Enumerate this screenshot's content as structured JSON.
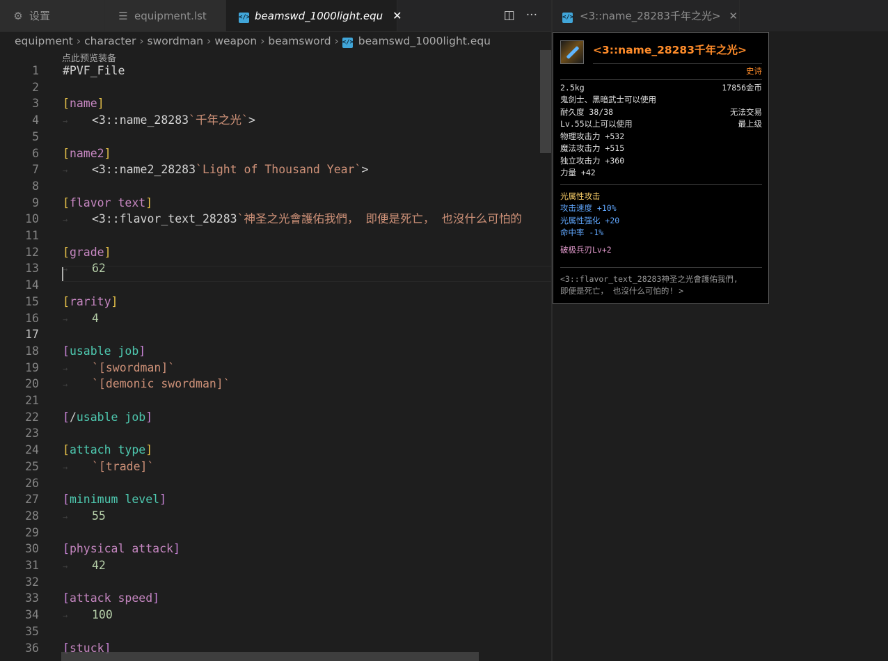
{
  "tabs": [
    {
      "label": "设置",
      "icon": "settings-sliders-icon"
    },
    {
      "label": "equipment.lst",
      "icon": "list-icon"
    },
    {
      "label": "beamswd_1000light.equ",
      "icon": "code-file-icon",
      "close": "✕"
    }
  ],
  "actions": {
    "split": "◫",
    "more": "···"
  },
  "breadcrumb": [
    "equipment",
    "character",
    "swordman",
    "weapon",
    "beamsword",
    "beamswd_1000light.equ"
  ],
  "codelens": "点此预览装备",
  "lines": [
    {
      "n": "1",
      "code": "#PVF_File"
    },
    {
      "n": "2",
      "code": ""
    },
    {
      "n": "3",
      "code": "[name]"
    },
    {
      "n": "4",
      "code": "<3::name_28283`千年之光`>"
    },
    {
      "n": "5",
      "code": ""
    },
    {
      "n": "6",
      "code": "[name2]"
    },
    {
      "n": "7",
      "code": "<3::name2_28283`Light of Thousand Year`>"
    },
    {
      "n": "8",
      "code": ""
    },
    {
      "n": "9",
      "code": "[flavor text]"
    },
    {
      "n": "10",
      "code": "<3::flavor_text_28283`神圣之光會護佑我們， 即便是死亡， 也沒什么可怕的"
    },
    {
      "n": "11",
      "code": ""
    },
    {
      "n": "12",
      "code": "[grade]"
    },
    {
      "n": "13",
      "code": "62"
    },
    {
      "n": "14",
      "code": ""
    },
    {
      "n": "15",
      "code": "[rarity]"
    },
    {
      "n": "16",
      "code": "4"
    },
    {
      "n": "17",
      "code": ""
    },
    {
      "n": "18",
      "code": "[usable job]"
    },
    {
      "n": "19",
      "code": "`[swordman]`"
    },
    {
      "n": "20",
      "code": "`[demonic swordman]`"
    },
    {
      "n": "21",
      "code": ""
    },
    {
      "n": "22",
      "code": "[/usable job]"
    },
    {
      "n": "23",
      "code": ""
    },
    {
      "n": "24",
      "code": "[attach type]"
    },
    {
      "n": "25",
      "code": "`[trade]`"
    },
    {
      "n": "26",
      "code": ""
    },
    {
      "n": "27",
      "code": "[minimum level]"
    },
    {
      "n": "28",
      "code": "55"
    },
    {
      "n": "29",
      "code": ""
    },
    {
      "n": "30",
      "code": "[physical attack]"
    },
    {
      "n": "31",
      "code": "42"
    },
    {
      "n": "32",
      "code": ""
    },
    {
      "n": "33",
      "code": "[attack speed]"
    },
    {
      "n": "34",
      "code": "100"
    },
    {
      "n": "35",
      "code": ""
    },
    {
      "n": "36",
      "code": "[stuck]"
    }
  ],
  "preview": {
    "tab_label": "<3::name_28283千年之光>",
    "tab_close": "✕",
    "tooltip": {
      "title": "<3::name_28283千年之光>",
      "rarity": "史诗",
      "weight": "2.5kg",
      "price": "17856金币",
      "jobs": "鬼剑士、黑暗武士可以使用",
      "durability": "耐久度 38/38",
      "trade": "无法交易",
      "level_req": "Lv.55以上可以使用",
      "grade": "最上级",
      "phys_atk": "物理攻击力 +532",
      "mag_atk": "魔法攻击力 +515",
      "ind_atk": "独立攻击力 +360",
      "str": "力量 +42",
      "element": "光属性攻击",
      "atk_speed": "攻击速度 +10%",
      "light_enh": "光属性强化 +20",
      "hit_rate": "命中率 -1%",
      "skill": "破极兵刃Lv+2",
      "flavor_1": "<3::flavor_text_28283神圣之光會護佑我們,",
      "flavor_2": "即便是死亡， 也沒什么可怕的! >"
    }
  }
}
